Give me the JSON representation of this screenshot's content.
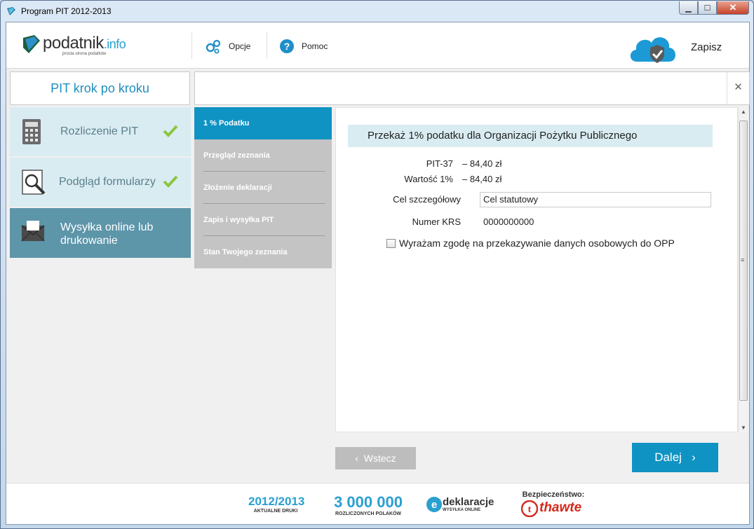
{
  "window": {
    "title": "Program PIT 2012-2013"
  },
  "header": {
    "logo_main": "podatnik",
    "logo_tld": ".info",
    "logo_sub": "prosta strona podatków",
    "options_label": "Opcje",
    "help_label": "Pomoc",
    "save_label": "Zapisz"
  },
  "left_title": "PIT krok po kroku",
  "left_nav": [
    {
      "label": "Rozliczenie PIT",
      "done": true
    },
    {
      "label": "Podgląd formularzy",
      "done": true
    },
    {
      "label_line1": "Wysyłka online lub",
      "label_line2": "drukowanie",
      "active": true
    }
  ],
  "steps": [
    "1 % Podatku",
    "Przegląd zeznania",
    "Złożenie deklaracji",
    "Zapis i wysyłka PIT",
    "Stan Twojego zeznania"
  ],
  "form": {
    "heading": "Przekaż 1% podatku dla Organizacji Pożytku Publicznego",
    "pit_label": "PIT-37",
    "pit_value": "–   84,40 zł",
    "pct_label": "Wartość 1%",
    "pct_value": "–   84,40 zł",
    "goal_label": "Cel szczegółowy",
    "goal_value": "Cel statutowy",
    "krs_label": "Numer KRS",
    "krs_value": "0000000000",
    "consent_label": "Wyrażam zgodę na przekazywanie danych osobowych do OPP",
    "consent_checked": false
  },
  "nav": {
    "back_label": "Wstecz",
    "next_label": "Dalej"
  },
  "footer": {
    "badge1_big": "2012/2013",
    "badge1_small": "AKTUALNE DRUKI",
    "badge2_big": "3 000 000",
    "badge2_small": "ROZLICZONYCH POLAKÓW",
    "badge3_big": "deklaracje",
    "badge3_small": "WYSYŁKA ONLINE",
    "badge4_title": "Bezpieczeństwo:",
    "badge4_brand": "thawte"
  },
  "colors": {
    "accent": "#0f93c3",
    "nav_active": "#5d95a9",
    "nav_bg": "#d9ecf2",
    "check": "#8cc63e"
  }
}
